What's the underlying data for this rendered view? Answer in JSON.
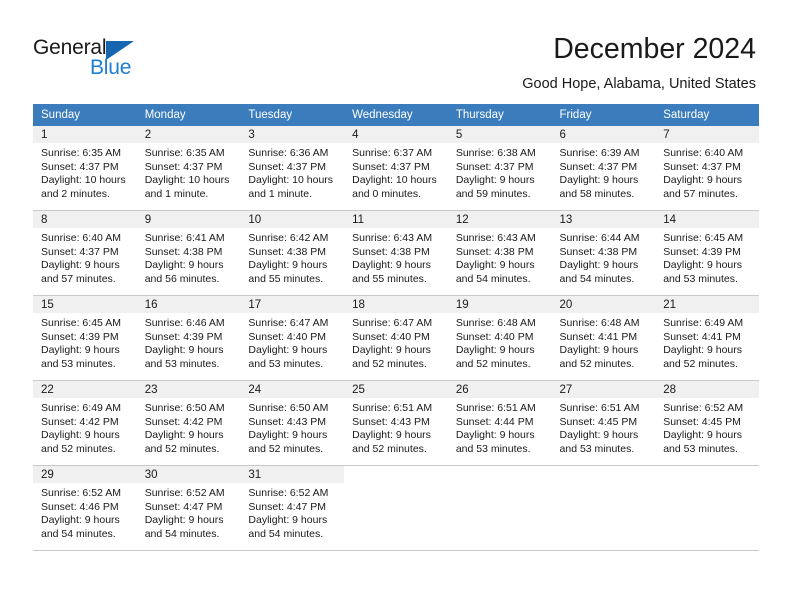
{
  "brand": {
    "name_part1": "General",
    "name_part2": "Blue",
    "triangle_icon": "blue-triangle-icon",
    "colors": {
      "dark": "#1a1a1a",
      "blue": "#1d7fd0",
      "triangle": "#1565b0"
    }
  },
  "header": {
    "title": "December 2024",
    "subtitle": "Good Hope, Alabama, United States"
  },
  "calendar": {
    "header_bg": "#3b7cbd",
    "daynum_bg": "#f0f0f0",
    "weekdays": [
      "Sunday",
      "Monday",
      "Tuesday",
      "Wednesday",
      "Thursday",
      "Friday",
      "Saturday"
    ],
    "weeks": [
      [
        {
          "day": "1",
          "sunrise": "Sunrise: 6:35 AM",
          "sunset": "Sunset: 4:37 PM",
          "daylight1": "Daylight: 10 hours",
          "daylight2": "and 2 minutes."
        },
        {
          "day": "2",
          "sunrise": "Sunrise: 6:35 AM",
          "sunset": "Sunset: 4:37 PM",
          "daylight1": "Daylight: 10 hours",
          "daylight2": "and 1 minute."
        },
        {
          "day": "3",
          "sunrise": "Sunrise: 6:36 AM",
          "sunset": "Sunset: 4:37 PM",
          "daylight1": "Daylight: 10 hours",
          "daylight2": "and 1 minute."
        },
        {
          "day": "4",
          "sunrise": "Sunrise: 6:37 AM",
          "sunset": "Sunset: 4:37 PM",
          "daylight1": "Daylight: 10 hours",
          "daylight2": "and 0 minutes."
        },
        {
          "day": "5",
          "sunrise": "Sunrise: 6:38 AM",
          "sunset": "Sunset: 4:37 PM",
          "daylight1": "Daylight: 9 hours",
          "daylight2": "and 59 minutes."
        },
        {
          "day": "6",
          "sunrise": "Sunrise: 6:39 AM",
          "sunset": "Sunset: 4:37 PM",
          "daylight1": "Daylight: 9 hours",
          "daylight2": "and 58 minutes."
        },
        {
          "day": "7",
          "sunrise": "Sunrise: 6:40 AM",
          "sunset": "Sunset: 4:37 PM",
          "daylight1": "Daylight: 9 hours",
          "daylight2": "and 57 minutes."
        }
      ],
      [
        {
          "day": "8",
          "sunrise": "Sunrise: 6:40 AM",
          "sunset": "Sunset: 4:37 PM",
          "daylight1": "Daylight: 9 hours",
          "daylight2": "and 57 minutes."
        },
        {
          "day": "9",
          "sunrise": "Sunrise: 6:41 AM",
          "sunset": "Sunset: 4:38 PM",
          "daylight1": "Daylight: 9 hours",
          "daylight2": "and 56 minutes."
        },
        {
          "day": "10",
          "sunrise": "Sunrise: 6:42 AM",
          "sunset": "Sunset: 4:38 PM",
          "daylight1": "Daylight: 9 hours",
          "daylight2": "and 55 minutes."
        },
        {
          "day": "11",
          "sunrise": "Sunrise: 6:43 AM",
          "sunset": "Sunset: 4:38 PM",
          "daylight1": "Daylight: 9 hours",
          "daylight2": "and 55 minutes."
        },
        {
          "day": "12",
          "sunrise": "Sunrise: 6:43 AM",
          "sunset": "Sunset: 4:38 PM",
          "daylight1": "Daylight: 9 hours",
          "daylight2": "and 54 minutes."
        },
        {
          "day": "13",
          "sunrise": "Sunrise: 6:44 AM",
          "sunset": "Sunset: 4:38 PM",
          "daylight1": "Daylight: 9 hours",
          "daylight2": "and 54 minutes."
        },
        {
          "day": "14",
          "sunrise": "Sunrise: 6:45 AM",
          "sunset": "Sunset: 4:39 PM",
          "daylight1": "Daylight: 9 hours",
          "daylight2": "and 53 minutes."
        }
      ],
      [
        {
          "day": "15",
          "sunrise": "Sunrise: 6:45 AM",
          "sunset": "Sunset: 4:39 PM",
          "daylight1": "Daylight: 9 hours",
          "daylight2": "and 53 minutes."
        },
        {
          "day": "16",
          "sunrise": "Sunrise: 6:46 AM",
          "sunset": "Sunset: 4:39 PM",
          "daylight1": "Daylight: 9 hours",
          "daylight2": "and 53 minutes."
        },
        {
          "day": "17",
          "sunrise": "Sunrise: 6:47 AM",
          "sunset": "Sunset: 4:40 PM",
          "daylight1": "Daylight: 9 hours",
          "daylight2": "and 53 minutes."
        },
        {
          "day": "18",
          "sunrise": "Sunrise: 6:47 AM",
          "sunset": "Sunset: 4:40 PM",
          "daylight1": "Daylight: 9 hours",
          "daylight2": "and 52 minutes."
        },
        {
          "day": "19",
          "sunrise": "Sunrise: 6:48 AM",
          "sunset": "Sunset: 4:40 PM",
          "daylight1": "Daylight: 9 hours",
          "daylight2": "and 52 minutes."
        },
        {
          "day": "20",
          "sunrise": "Sunrise: 6:48 AM",
          "sunset": "Sunset: 4:41 PM",
          "daylight1": "Daylight: 9 hours",
          "daylight2": "and 52 minutes."
        },
        {
          "day": "21",
          "sunrise": "Sunrise: 6:49 AM",
          "sunset": "Sunset: 4:41 PM",
          "daylight1": "Daylight: 9 hours",
          "daylight2": "and 52 minutes."
        }
      ],
      [
        {
          "day": "22",
          "sunrise": "Sunrise: 6:49 AM",
          "sunset": "Sunset: 4:42 PM",
          "daylight1": "Daylight: 9 hours",
          "daylight2": "and 52 minutes."
        },
        {
          "day": "23",
          "sunrise": "Sunrise: 6:50 AM",
          "sunset": "Sunset: 4:42 PM",
          "daylight1": "Daylight: 9 hours",
          "daylight2": "and 52 minutes."
        },
        {
          "day": "24",
          "sunrise": "Sunrise: 6:50 AM",
          "sunset": "Sunset: 4:43 PM",
          "daylight1": "Daylight: 9 hours",
          "daylight2": "and 52 minutes."
        },
        {
          "day": "25",
          "sunrise": "Sunrise: 6:51 AM",
          "sunset": "Sunset: 4:43 PM",
          "daylight1": "Daylight: 9 hours",
          "daylight2": "and 52 minutes."
        },
        {
          "day": "26",
          "sunrise": "Sunrise: 6:51 AM",
          "sunset": "Sunset: 4:44 PM",
          "daylight1": "Daylight: 9 hours",
          "daylight2": "and 53 minutes."
        },
        {
          "day": "27",
          "sunrise": "Sunrise: 6:51 AM",
          "sunset": "Sunset: 4:45 PM",
          "daylight1": "Daylight: 9 hours",
          "daylight2": "and 53 minutes."
        },
        {
          "day": "28",
          "sunrise": "Sunrise: 6:52 AM",
          "sunset": "Sunset: 4:45 PM",
          "daylight1": "Daylight: 9 hours",
          "daylight2": "and 53 minutes."
        }
      ],
      [
        {
          "day": "29",
          "sunrise": "Sunrise: 6:52 AM",
          "sunset": "Sunset: 4:46 PM",
          "daylight1": "Daylight: 9 hours",
          "daylight2": "and 54 minutes."
        },
        {
          "day": "30",
          "sunrise": "Sunrise: 6:52 AM",
          "sunset": "Sunset: 4:47 PM",
          "daylight1": "Daylight: 9 hours",
          "daylight2": "and 54 minutes."
        },
        {
          "day": "31",
          "sunrise": "Sunrise: 6:52 AM",
          "sunset": "Sunset: 4:47 PM",
          "daylight1": "Daylight: 9 hours",
          "daylight2": "and 54 minutes."
        },
        {
          "day": "",
          "sunrise": "",
          "sunset": "",
          "daylight1": "",
          "daylight2": ""
        },
        {
          "day": "",
          "sunrise": "",
          "sunset": "",
          "daylight1": "",
          "daylight2": ""
        },
        {
          "day": "",
          "sunrise": "",
          "sunset": "",
          "daylight1": "",
          "daylight2": ""
        },
        {
          "day": "",
          "sunrise": "",
          "sunset": "",
          "daylight1": "",
          "daylight2": ""
        }
      ]
    ]
  }
}
